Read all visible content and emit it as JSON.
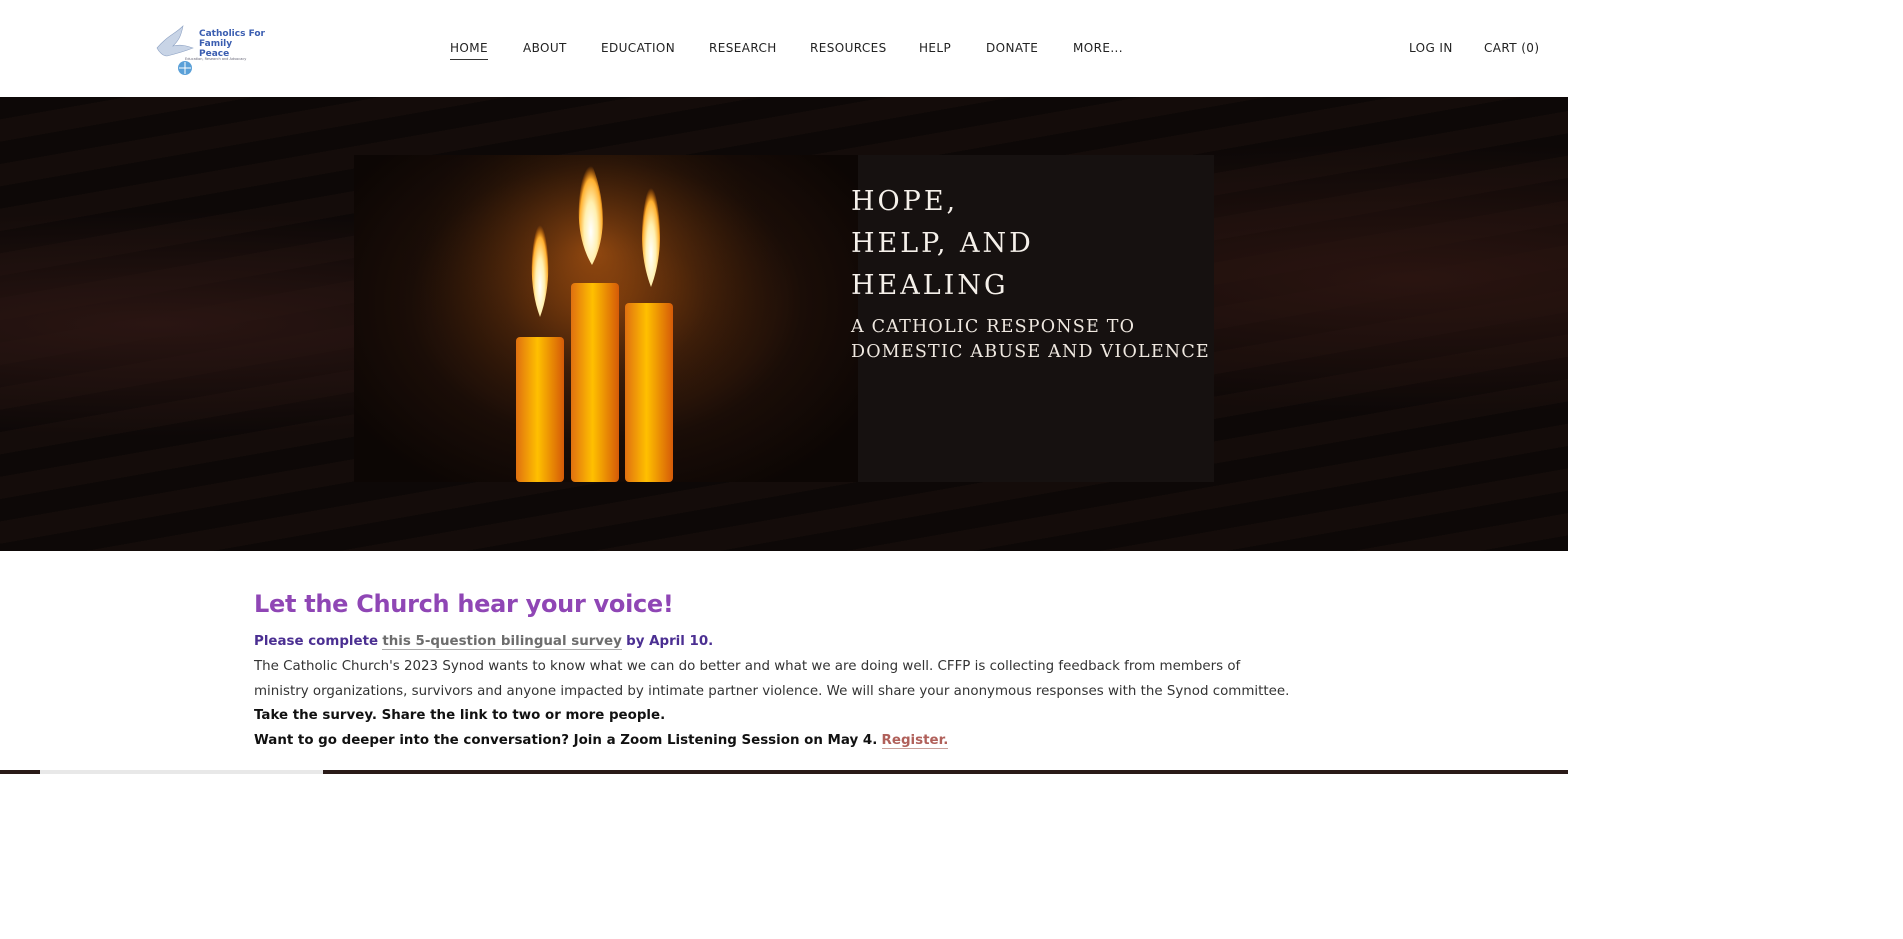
{
  "logo": {
    "line1": "Catholics For",
    "line2": "Family Peace",
    "tagline": "Education, Research and Advocacy"
  },
  "nav": {
    "items": [
      "HOME",
      "ABOUT",
      "EDUCATION",
      "RESEARCH",
      "RESOURCES",
      "HELP",
      "DONATE",
      "MORE..."
    ],
    "login": "LOG IN",
    "cart": "CART (0)"
  },
  "hero": {
    "title_lines": [
      "HOPE,",
      "HELP, AND",
      "HEALING"
    ],
    "subtitle_lines": [
      "A CATHOLIC RESPONSE TO",
      "DOMESTIC ABUSE AND VIOLENCE"
    ]
  },
  "content": {
    "headline": "Let the Church hear your voice!",
    "survey_prefix": "Please complete",
    "survey_link": "this 5-question bilingual survey",
    "survey_suffix": "by April 10.",
    "body_line1": "The Catholic Church's 2023 Synod wants to know what we can do better and what we are doing well. CFFP is collecting feedback from members of",
    "body_line2": "ministry organizations, survivors and anyone impacted by intimate partner violence. We will share your anonymous responses with the Synod committee.",
    "take_survey": "Take the survey. Share the link to two or more people.",
    "zoom_text": "Want to go deeper into the conversation? Join a Zoom Listening Session on May 4.",
    "register_link": "Register."
  },
  "colors": {
    "headline": "#8f46b5",
    "survey_text": "#4b2f92",
    "register_link": "#b0605a"
  }
}
